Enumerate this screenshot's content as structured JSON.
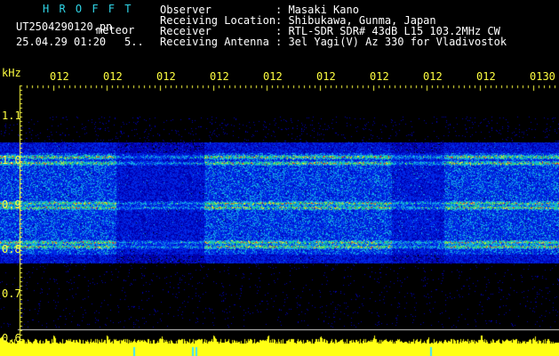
{
  "header": {
    "brand": "H R O F F T",
    "filename": "UT2504290120.pn",
    "mode": "meteor",
    "datetime": "25.04.29 01:20",
    "interval": "5..",
    "fields": [
      {
        "label": "Observer",
        "value": ": Masaki Kano"
      },
      {
        "label": "Receiving Location",
        "value": ": Shibukawa, Gunma, Japan"
      },
      {
        "label": "Receiver",
        "value": ": RTL-SDR SDR# 43dB L15 103.2MHz CW"
      },
      {
        "label": "Receiving Antenna",
        "value": ": 3el Yagi(V) Az 330 for Vladivostok"
      }
    ]
  },
  "axis": {
    "unit": "kHz",
    "y_ticks": [
      "1.1",
      "1.0",
      "0.9",
      "0.8",
      "0.7",
      "0.6"
    ],
    "time_ticks": [
      "012",
      "012",
      "012",
      "012",
      "012",
      "012",
      "012",
      "012",
      "012",
      "0130"
    ]
  },
  "colors": {
    "cyan": "#2fd4e6",
    "yellow": "#ffff40",
    "background": "#000000"
  }
}
